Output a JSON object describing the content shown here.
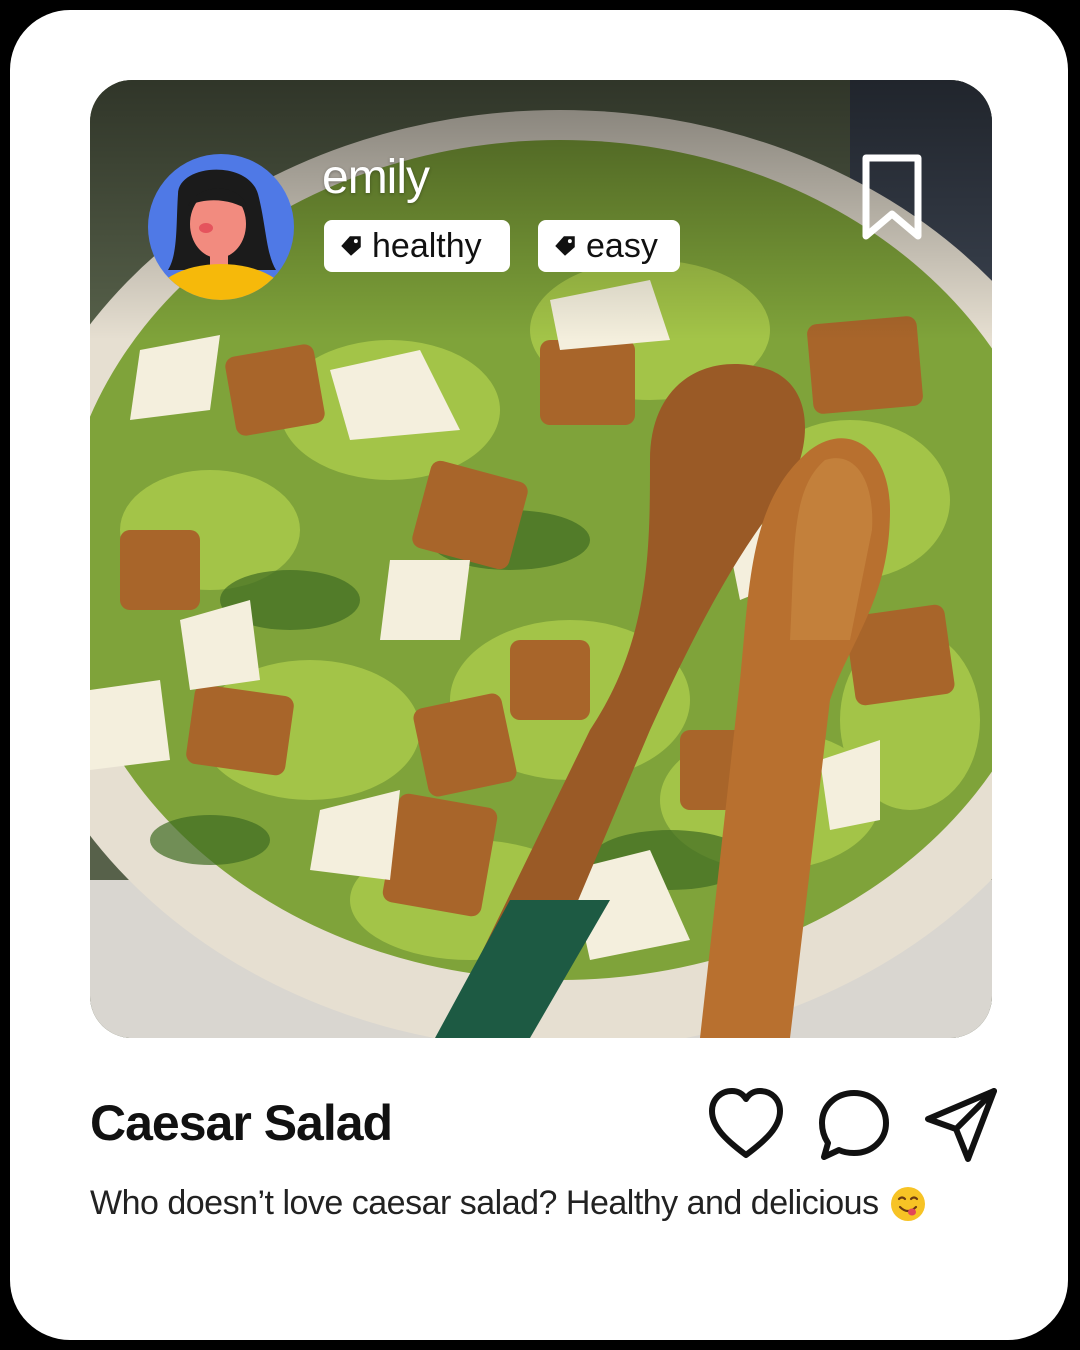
{
  "post": {
    "username": "emily",
    "tags": [
      "healthy",
      "easy"
    ],
    "title": "Caesar Salad",
    "caption": "Who doesn’t love caesar salad? Healthy and delicious",
    "caption_emoji": "yum-face-emoji",
    "photo_subject": "caesar-salad-photo"
  },
  "icons": {
    "bookmark": "bookmark-icon",
    "like": "heart-icon",
    "comment": "comment-bubble-icon",
    "share": "send-icon",
    "tag": "tag-icon"
  },
  "colors": {
    "avatar_bg": "#4f79e6",
    "avatar_shirt": "#f6b90a",
    "text_primary": "#111111",
    "card_bg": "#ffffff"
  }
}
